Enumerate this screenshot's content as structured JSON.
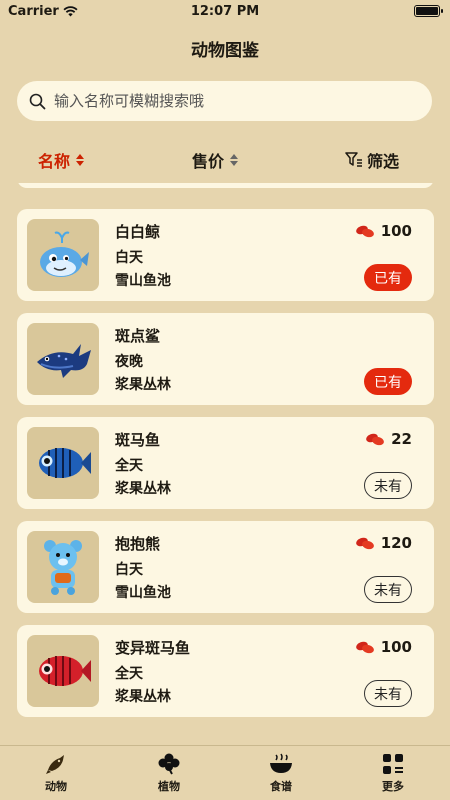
{
  "status_bar": {
    "carrier": "Carrier",
    "time": "12:07 PM"
  },
  "nav": {
    "title": "动物图鉴"
  },
  "search": {
    "placeholder": "输入名称可模糊搜索哦"
  },
  "sort_bar": {
    "name_label": "名称",
    "price_label": "售价",
    "filter_label": "筛选"
  },
  "animals": [
    {
      "name": "白白鲸",
      "time": "白天",
      "place": "雪山鱼池",
      "price": "100",
      "status": "已有",
      "owned": true,
      "icon": "white-whale-icon"
    },
    {
      "name": "斑点鲨",
      "time": "夜晚",
      "place": "浆果丛林",
      "price": "",
      "status": "已有",
      "owned": true,
      "icon": "spotted-shark-icon"
    },
    {
      "name": "斑马鱼",
      "time": "全天",
      "place": "浆果丛林",
      "price": "22",
      "status": "未有",
      "owned": false,
      "icon": "zebra-fish-icon"
    },
    {
      "name": "抱抱熊",
      "time": "白天",
      "place": "雪山鱼池",
      "price": "120",
      "status": "未有",
      "owned": false,
      "icon": "hug-bear-icon"
    },
    {
      "name": "变异斑马鱼",
      "time": "全天",
      "place": "浆果丛林",
      "price": "100",
      "status": "未有",
      "owned": false,
      "icon": "mutant-zebra-fish-icon"
    }
  ],
  "tabs": [
    {
      "label": "动物",
      "icon": "fish-icon",
      "active": true
    },
    {
      "label": "植物",
      "icon": "clover-icon",
      "active": false
    },
    {
      "label": "食谱",
      "icon": "bowl-icon",
      "active": false
    },
    {
      "label": "更多",
      "icon": "grid-icon",
      "active": false
    }
  ],
  "colors": {
    "background": "#e6d5ae",
    "card": "#fdf7e2",
    "accent": "#cc2200",
    "owned_badge": "#e42a0e"
  }
}
